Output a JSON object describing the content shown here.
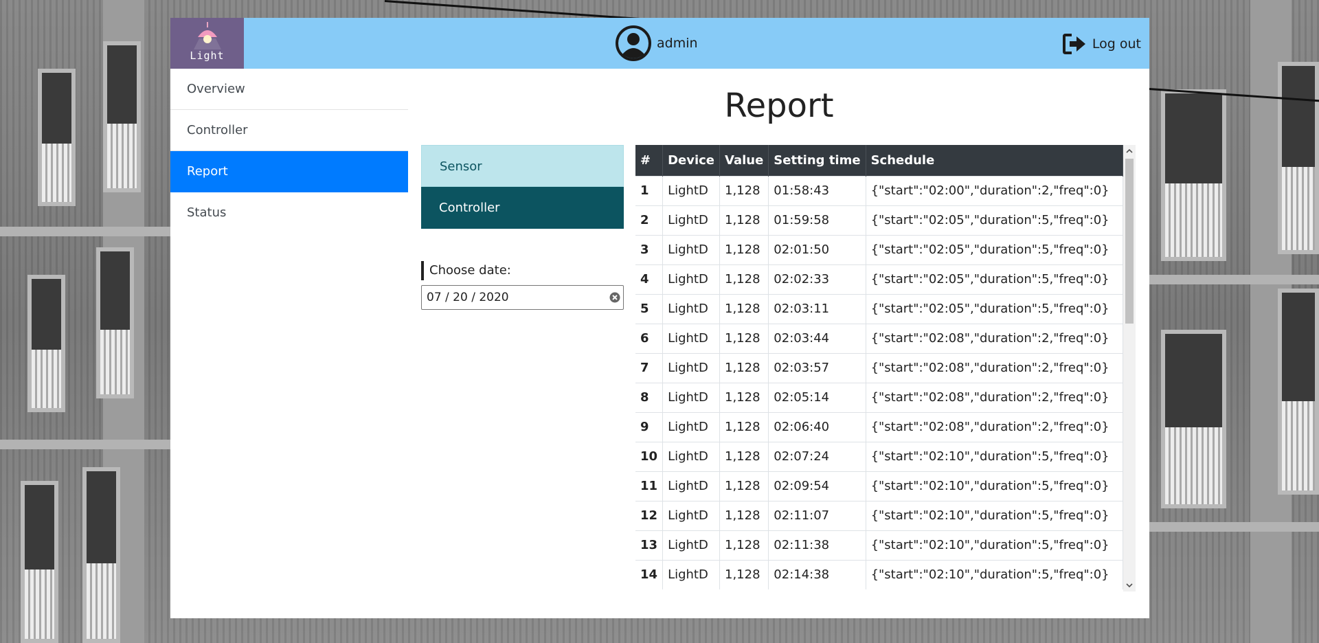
{
  "brand": {
    "name": "Light",
    "icon": "lamp-icon"
  },
  "header": {
    "username": "admin",
    "logout_label": "Log out",
    "user_icon": "user-circle-icon",
    "logout_icon": "logout-icon"
  },
  "sidebar": {
    "items": [
      {
        "label": "Overview",
        "active": false
      },
      {
        "label": "Controller",
        "active": false
      },
      {
        "label": "Report",
        "active": true
      },
      {
        "label": "Status",
        "active": false
      }
    ]
  },
  "main": {
    "title": "Report",
    "tabs": [
      {
        "label": "Sensor",
        "active": false
      },
      {
        "label": "Controller",
        "active": true
      }
    ],
    "date_label": "Choose date:",
    "date_value": "07 / 20 / 2020"
  },
  "table": {
    "headers": [
      "#",
      "Device",
      "Value",
      "Setting time",
      "Schedule"
    ],
    "rows": [
      [
        "1",
        "LightD",
        "1,128",
        "01:58:43",
        "{\"start\":\"02:00\",\"duration\":2,\"freq\":0}"
      ],
      [
        "2",
        "LightD",
        "1,128",
        "01:59:58",
        "{\"start\":\"02:05\",\"duration\":5,\"freq\":0}"
      ],
      [
        "3",
        "LightD",
        "1,128",
        "02:01:50",
        "{\"start\":\"02:05\",\"duration\":5,\"freq\":0}"
      ],
      [
        "4",
        "LightD",
        "1,128",
        "02:02:33",
        "{\"start\":\"02:05\",\"duration\":5,\"freq\":0}"
      ],
      [
        "5",
        "LightD",
        "1,128",
        "02:03:11",
        "{\"start\":\"02:05\",\"duration\":5,\"freq\":0}"
      ],
      [
        "6",
        "LightD",
        "1,128",
        "02:03:44",
        "{\"start\":\"02:08\",\"duration\":2,\"freq\":0}"
      ],
      [
        "7",
        "LightD",
        "1,128",
        "02:03:57",
        "{\"start\":\"02:08\",\"duration\":2,\"freq\":0}"
      ],
      [
        "8",
        "LightD",
        "1,128",
        "02:05:14",
        "{\"start\":\"02:08\",\"duration\":2,\"freq\":0}"
      ],
      [
        "9",
        "LightD",
        "1,128",
        "02:06:40",
        "{\"start\":\"02:08\",\"duration\":2,\"freq\":0}"
      ],
      [
        "10",
        "LightD",
        "1,128",
        "02:07:24",
        "{\"start\":\"02:10\",\"duration\":5,\"freq\":0}"
      ],
      [
        "11",
        "LightD",
        "1,128",
        "02:09:54",
        "{\"start\":\"02:10\",\"duration\":5,\"freq\":0}"
      ],
      [
        "12",
        "LightD",
        "1,128",
        "02:11:07",
        "{\"start\":\"02:10\",\"duration\":5,\"freq\":0}"
      ],
      [
        "13",
        "LightD",
        "1,128",
        "02:11:38",
        "{\"start\":\"02:10\",\"duration\":5,\"freq\":0}"
      ],
      [
        "14",
        "LightD",
        "1,128",
        "02:14:38",
        "{\"start\":\"02:10\",\"duration\":5,\"freq\":0}"
      ]
    ]
  },
  "colors": {
    "header_bg": "#87cbf7",
    "brand_bg": "#6f5f8a",
    "nav_active": "#007bff",
    "tab_sensor_bg": "#bde5ec",
    "tab_controller_bg": "#0c5460",
    "table_head_bg": "#343a40"
  }
}
